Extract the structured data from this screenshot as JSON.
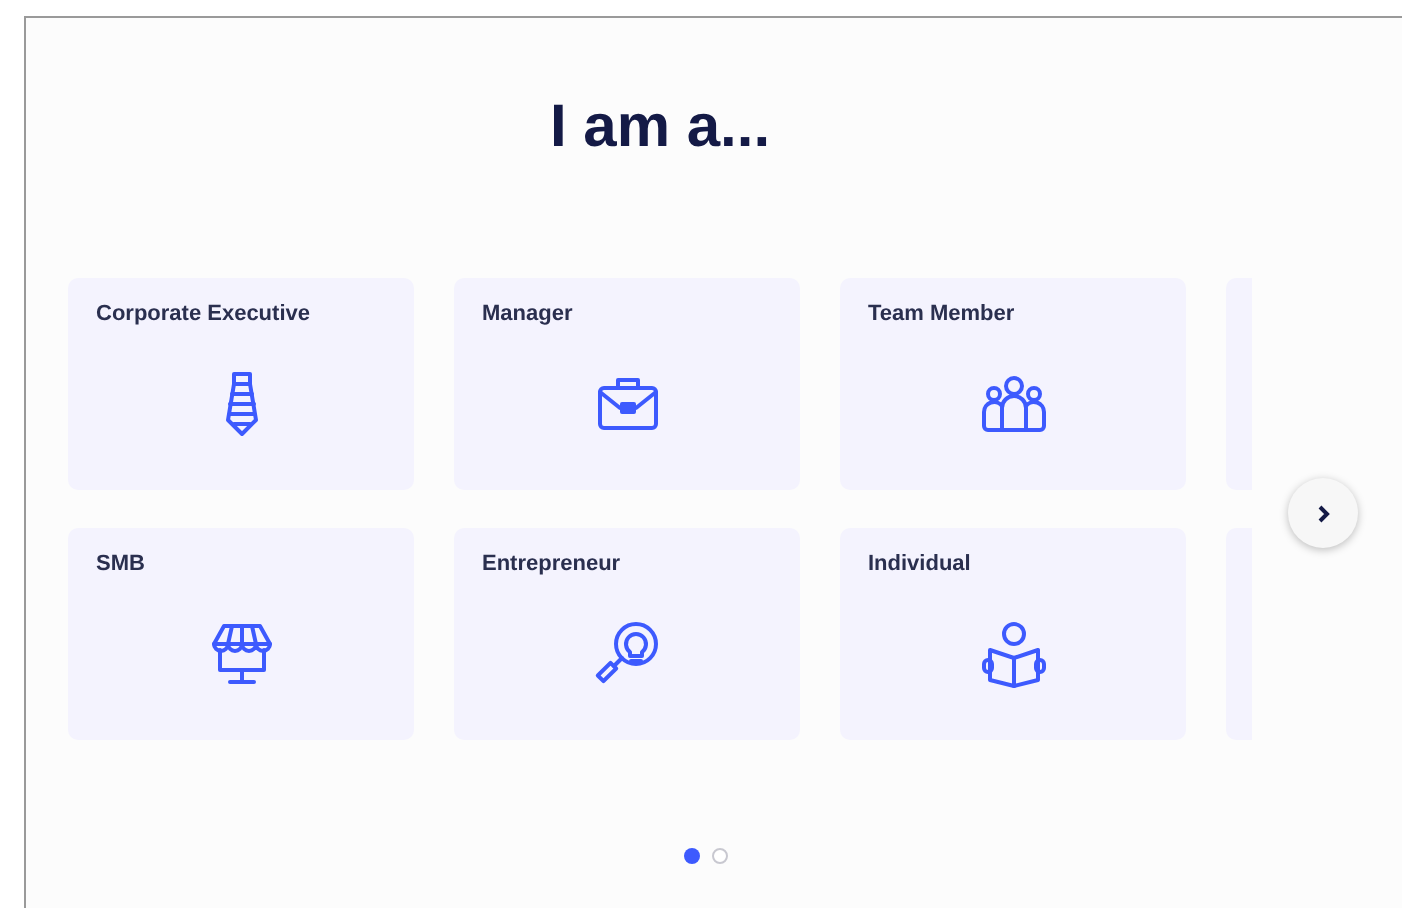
{
  "heading": "I am a...",
  "cards": [
    {
      "label": "Corporate Executive",
      "kind": "tie"
    },
    {
      "label": "Manager",
      "kind": "briefcase"
    },
    {
      "label": "Team Member",
      "kind": "group"
    },
    {
      "kind": "blank"
    },
    {
      "label": "SMB",
      "kind": "shop"
    },
    {
      "label": "Entrepreneur",
      "kind": "idea"
    },
    {
      "label": "Individual",
      "kind": "reader"
    },
    {
      "kind": "blank"
    }
  ],
  "pager": [
    {
      "selected": true
    },
    {
      "selected": false
    }
  ]
}
